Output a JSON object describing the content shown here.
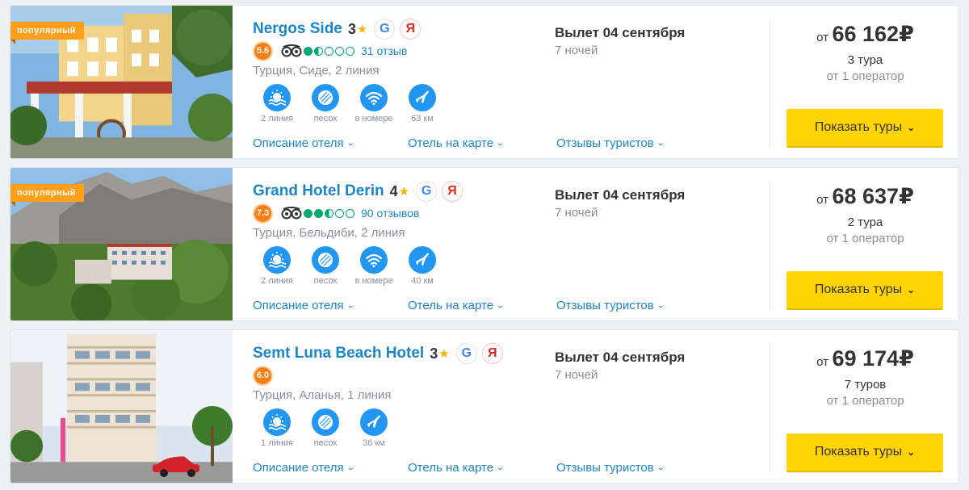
{
  "hotels": [
    {
      "badge": "популярный",
      "name": "Nergos Side",
      "stars": "3",
      "google": "G",
      "yandex": "Я",
      "score": "5.6",
      "bubbles": [
        1,
        0.5,
        0,
        0,
        0
      ],
      "reviews": "31 отзыв",
      "location": "Турция, Сиде, 2 линия",
      "features": [
        {
          "icon": "beach-icon",
          "label": "2 линия"
        },
        {
          "icon": "sand-icon",
          "label": "песок"
        },
        {
          "icon": "wifi-icon",
          "label": "в номере"
        },
        {
          "icon": "airport-icon",
          "label": "63 км"
        }
      ],
      "links": {
        "description": "Описание отеля",
        "map": "Отель на карте",
        "reviews": "Отзывы туристов"
      },
      "departure": "Вылет 04 сентября",
      "nights": "7 ночей",
      "price_from": "от",
      "price": "66 162₽",
      "tours": "3 тура",
      "operators": "от 1 оператор",
      "button": "Показать туры"
    },
    {
      "badge": "популярный",
      "name": "Grand Hotel Derin",
      "stars": "4",
      "google": "G",
      "yandex": "Я",
      "score": "7.3",
      "bubbles": [
        1,
        1,
        0.5,
        0,
        0
      ],
      "reviews": "90 отзывов",
      "location": "Турция, Бельдиби, 2 линия",
      "features": [
        {
          "icon": "beach-icon",
          "label": "2 линия"
        },
        {
          "icon": "sand-icon",
          "label": "песок"
        },
        {
          "icon": "wifi-icon",
          "label": "в номере"
        },
        {
          "icon": "airport-icon",
          "label": "40 км"
        }
      ],
      "links": {
        "description": "Описание отеля",
        "map": "Отель на карте",
        "reviews": "Отзывы туристов"
      },
      "departure": "Вылет 04 сентября",
      "nights": "7 ночей",
      "price_from": "от",
      "price": "68 637₽",
      "tours": "2 тура",
      "operators": "от 1 оператор",
      "button": "Показать туры"
    },
    {
      "badge": "",
      "name": "Semt Luna Beach Hotel",
      "stars": "3",
      "google": "G",
      "yandex": "Я",
      "score": "6.0",
      "bubbles": [],
      "reviews": "",
      "location": "Турция, Аланья, 1 линия",
      "features": [
        {
          "icon": "beach-icon",
          "label": "1 линия"
        },
        {
          "icon": "sand-icon",
          "label": "песок"
        },
        {
          "icon": "airport-icon",
          "label": "36 км"
        }
      ],
      "links": {
        "description": "Описание отеля",
        "map": "Отель на карте",
        "reviews": "Отзывы туристов"
      },
      "departure": "Вылет 04 сентября",
      "nights": "7 ночей",
      "price_from": "от",
      "price": "69 174₽",
      "tours": "7 туров",
      "operators": "от 1 оператор",
      "button": "Показать туры"
    }
  ],
  "colors": {
    "accent": "#1a86c7",
    "button": "#ffd400",
    "badge": "#ff9f1a",
    "score": "#f57e17",
    "feature": "#2196f3",
    "tripadvisor": "#00aa6c"
  }
}
